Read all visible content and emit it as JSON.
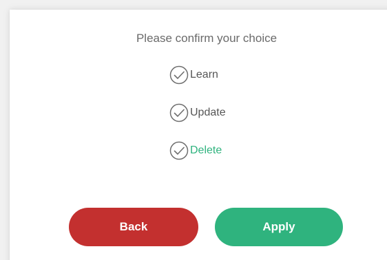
{
  "dialog": {
    "title": "Please confirm your choice",
    "options": [
      {
        "label": "Learn",
        "icon": "check-circle-icon",
        "selected": false
      },
      {
        "label": "Update",
        "icon": "check-circle-icon",
        "selected": false
      },
      {
        "label": "Delete",
        "icon": "check-circle-icon",
        "selected": true
      }
    ],
    "buttons": {
      "back_label": "Back",
      "apply_label": "Apply"
    }
  },
  "colors": {
    "back": "#c3302f",
    "apply": "#2fb37e",
    "selected_text": "#2fb37e",
    "text": "#555555",
    "title": "#6a6a6a"
  }
}
